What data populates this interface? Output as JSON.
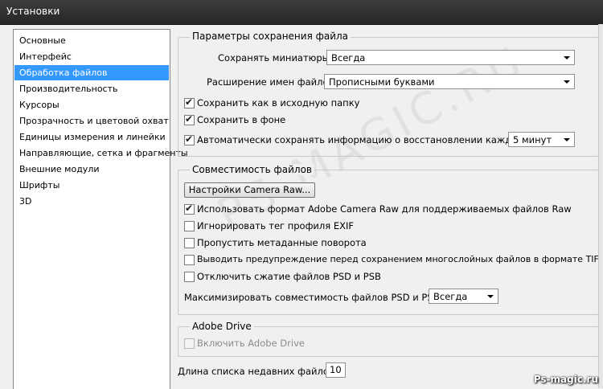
{
  "window": {
    "title": "Установки"
  },
  "sidebar": {
    "items": [
      {
        "label": "Основные"
      },
      {
        "label": "Интерфейс"
      },
      {
        "label": "Обработка файлов"
      },
      {
        "label": "Производительность"
      },
      {
        "label": "Курсоры"
      },
      {
        "label": "Прозрачность и цветовой охват"
      },
      {
        "label": "Единицы измерения и линейки"
      },
      {
        "label": "Направляющие, сетка и фрагменты"
      },
      {
        "label": "Внешние модули"
      },
      {
        "label": "Шрифты"
      },
      {
        "label": "3D"
      }
    ],
    "selected": "Обработка файлов"
  },
  "save_options": {
    "legend": "Параметры сохранения файла",
    "thumbnails_label": "Сохранять миниатюры:",
    "thumbnails_value": "Всегда",
    "extension_label": "Расширение имен файлов:",
    "extension_value": "Прописными буквами",
    "save_original_folder": {
      "label": "Сохранить как в исходную папку",
      "checked": true
    },
    "save_background": {
      "label": "Сохранить в фоне",
      "checked": true
    },
    "autosave": {
      "label": "Автоматически сохранять информацию о восстановлении каждые:",
      "checked": true
    },
    "autosave_interval": "5 минут"
  },
  "compat": {
    "legend": "Совместимость файлов",
    "camera_raw_button": "Настройки Camera Raw...",
    "use_camera_raw": {
      "label": "Использовать формат Adobe Camera Raw для поддерживаемых файлов Raw",
      "checked": true
    },
    "ignore_exif": {
      "label": "Игнорировать тег профиля EXIF",
      "checked": false
    },
    "skip_rotation": {
      "label": "Пропустить метаданные поворота",
      "checked": false
    },
    "warn_tiff": {
      "label": "Выводить предупреждение перед сохранением многослойных файлов в формате TIFF",
      "checked": false
    },
    "disable_compression": {
      "label": "Отключить сжатие файлов PSD и PSB",
      "checked": false
    },
    "maximize_label": "Максимизировать совместимость файлов PSD и PSB:",
    "maximize_value": "Всегда"
  },
  "adobe_drive": {
    "legend": "Adobe Drive",
    "enable": {
      "label": "Включить Adobe Drive",
      "checked": false,
      "disabled": true
    }
  },
  "recent_files": {
    "label": "Длина списка недавних файлов:",
    "value": "10"
  },
  "watermark": "PS-MAGIC.RU",
  "site_mark": "Ps-magic.ru"
}
